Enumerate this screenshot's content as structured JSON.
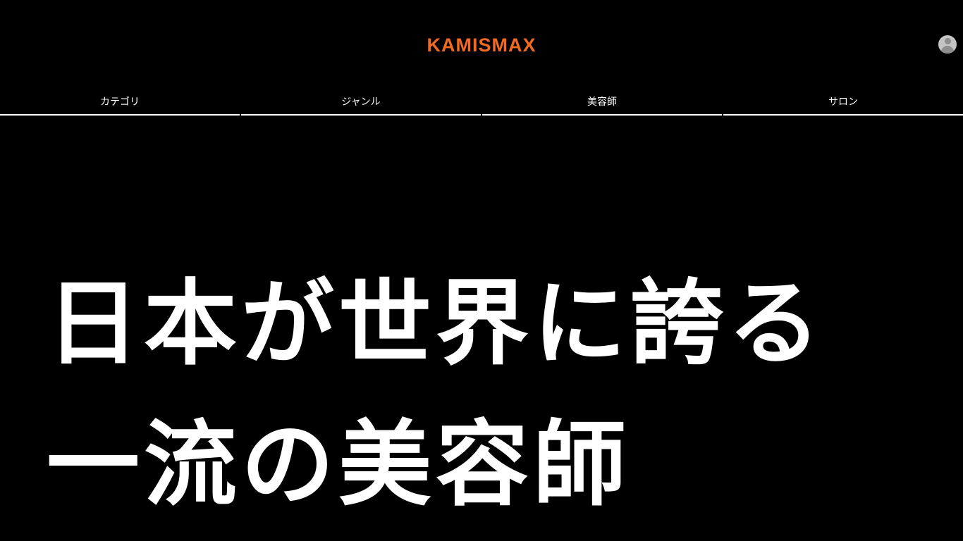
{
  "header": {
    "logo_text": "KAMISMAX",
    "logo_color": "#f26a21",
    "avatar_icon": "user-avatar-icon"
  },
  "nav": {
    "tabs": [
      {
        "label": "カテゴリ"
      },
      {
        "label": "ジャンル"
      },
      {
        "label": "美容師"
      },
      {
        "label": "サロン"
      }
    ]
  },
  "hero": {
    "line1": "日本が世界に誇る",
    "line2": "一流の美容師"
  },
  "colors": {
    "background": "#000000",
    "text": "#ffffff",
    "accent": "#f26a21"
  }
}
